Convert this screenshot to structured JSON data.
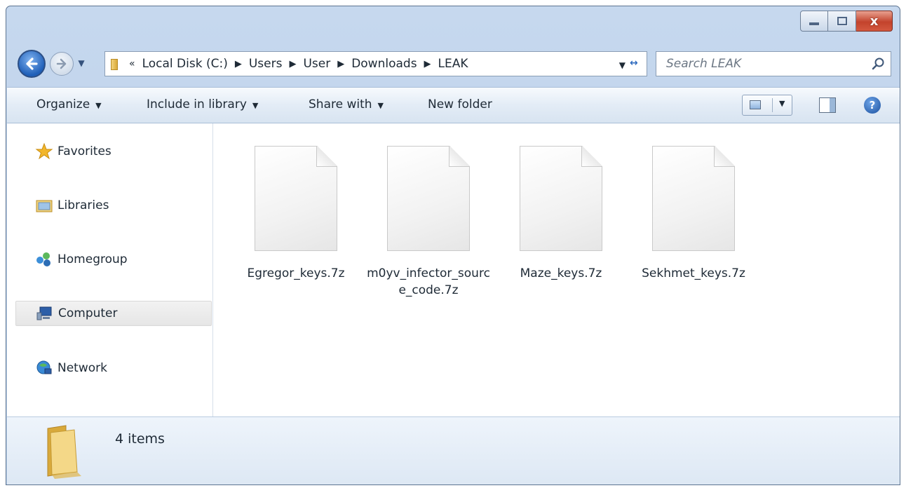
{
  "window": {
    "minimize_label": "",
    "maximize_label": "",
    "close_label": "x"
  },
  "nav": {
    "breadcrumb_overflow": "«",
    "breadcrumbs": [
      "Local Disk (C:)",
      "Users",
      "User",
      "Downloads",
      "LEAK"
    ],
    "search_placeholder": "Search LEAK"
  },
  "commands": {
    "organize": "Organize",
    "include_in_library": "Include in library",
    "share_with": "Share with",
    "new_folder": "New folder",
    "help": "?"
  },
  "sidebar": {
    "items": [
      {
        "label": "Favorites",
        "icon": "star-icon"
      },
      {
        "label": "Libraries",
        "icon": "libraries-icon"
      },
      {
        "label": "Homegroup",
        "icon": "homegroup-icon"
      },
      {
        "label": "Computer",
        "icon": "computer-icon",
        "selected": true
      },
      {
        "label": "Network",
        "icon": "network-icon"
      }
    ]
  },
  "files": [
    {
      "name": "Egregor_keys.7z",
      "icon": "file-icon"
    },
    {
      "name": "m0yv_infector_source_code.7z",
      "icon": "file-icon"
    },
    {
      "name": "Maze_keys.7z",
      "icon": "file-icon"
    },
    {
      "name": "Sekhmet_keys.7z",
      "icon": "file-icon"
    }
  ],
  "details": {
    "item_count": "4 items"
  },
  "colors": {
    "accent": "#2f6bbf",
    "close_button": "#c3432c",
    "folder": "#e8c15a"
  }
}
